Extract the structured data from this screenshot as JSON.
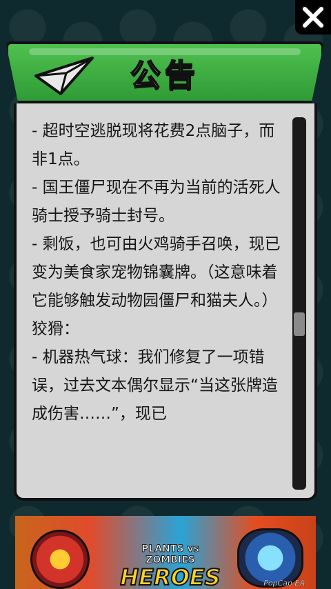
{
  "dialog": {
    "title": "公告",
    "paragraphs": [
      "- 超时空逃脱现将花费2点脑子，而非1点。",
      "- 国王僵尸现在不再为当前的活死人骑士授予骑士封号。",
      "- 剩饭，也可由火鸡骑手召唤，现已变为美食家宠物锦囊牌。（这意味着它能够触发动物园僵尸和猫夫人。）",
      "",
      "狡猾：",
      "- 机器热气球：我们修复了一项错误，过去文本偶尔显示“当这张牌造成伤害……”，现已"
    ],
    "scroll_position": 0.56
  },
  "icons": {
    "close": "close-x-icon",
    "header_decor": "paper-plane-icon"
  },
  "ad": {
    "logo_top": "PLANTS vs ZOMBIES",
    "logo_main": "HEROES",
    "credit": "PopCap EA"
  },
  "colors": {
    "header_green": "#3aa83f",
    "panel_bg": "#d6d6d6",
    "outline": "#111111",
    "title_text": "#ffffff"
  }
}
